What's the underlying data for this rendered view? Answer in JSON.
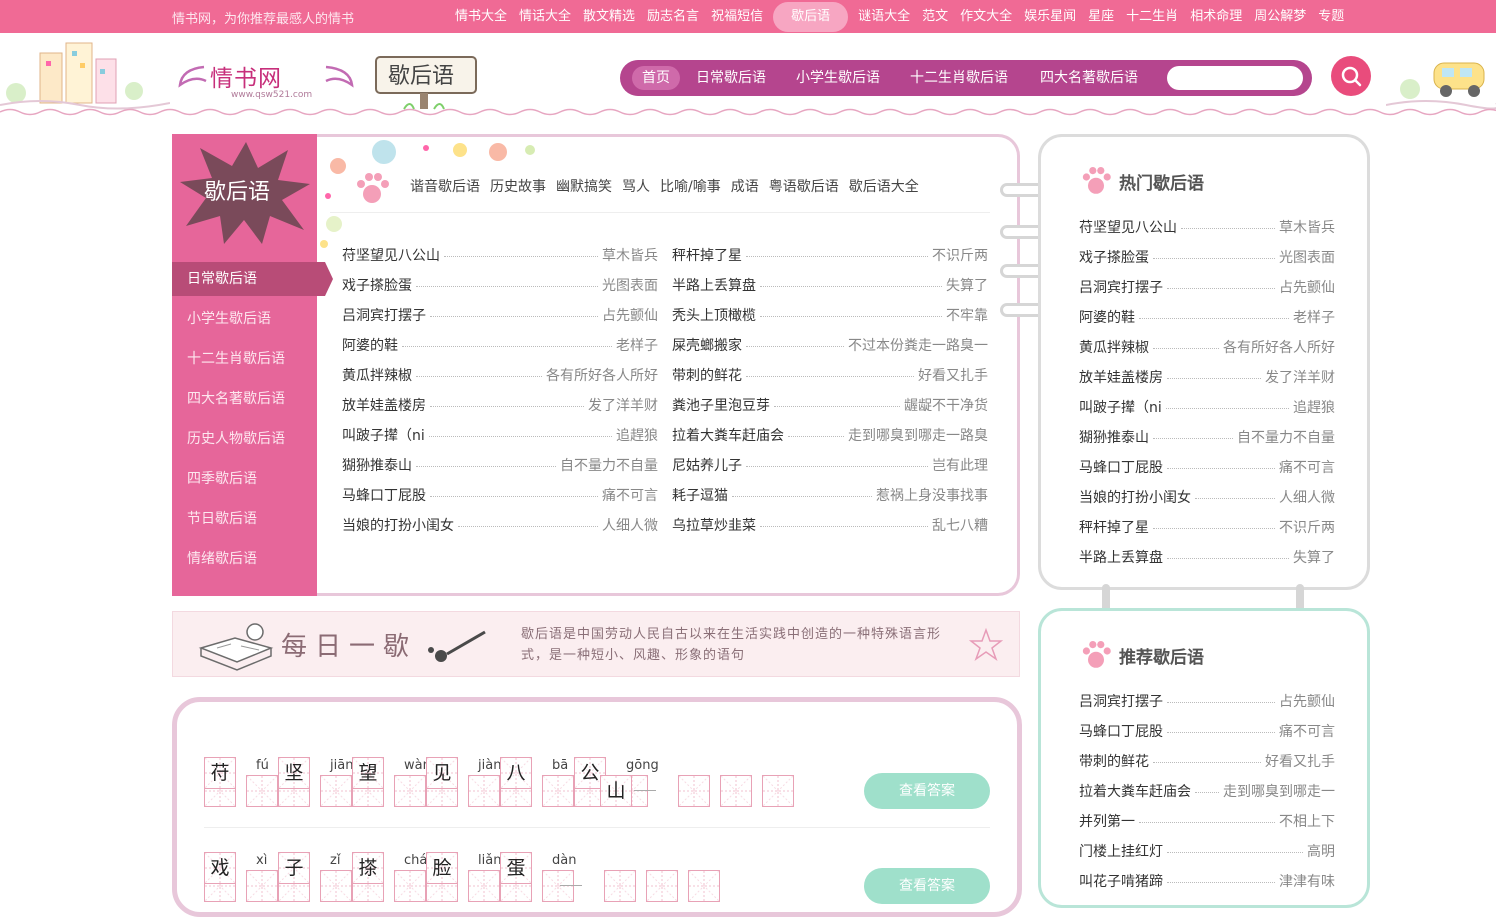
{
  "topbar": {
    "slogan": "情书网，为你推荐最感人的情书",
    "links": [
      "情书大全",
      "情话大全",
      "散文精选",
      "励志名言",
      "祝福短信",
      "歇后语",
      "谜语大全",
      "范文",
      "作文大全",
      "娱乐星闻",
      "星座",
      "十二生肖",
      "相术命理",
      "周公解梦",
      "专题"
    ],
    "active_index": 5
  },
  "header": {
    "logo_text": "情书网",
    "logo_url": "www.qsw521.com",
    "section_tag": "歇后语",
    "nav": [
      "首页",
      "日常歇后语",
      "小学生歇后语",
      "十二生肖歇后语",
      "四大名著歇后语"
    ],
    "search_placeholder": ""
  },
  "sidemenu": {
    "badge": "歇后语",
    "items": [
      "日常歇后语",
      "小学生歇后语",
      "十二生肖歇后语",
      "四大名著歇后语",
      "历史人物歇后语",
      "四季歇后语",
      "节日歇后语",
      "情绪歇后语"
    ],
    "active_index": 0
  },
  "subnav": [
    "谐音歇后语",
    "历史故事",
    "幽默搞笑",
    "骂人",
    "比喻/喻事",
    "成语",
    "粤语歇后语",
    "歇后语大全"
  ],
  "main_list_left": [
    {
      "q": "苻坚望见八公山",
      "a": "草木皆兵"
    },
    {
      "q": "戏子搽脸蛋",
      "a": "光图表面"
    },
    {
      "q": "吕洞宾打摆子",
      "a": "占先颤仙"
    },
    {
      "q": "阿婆的鞋",
      "a": "老样子"
    },
    {
      "q": "黄瓜拌辣椒",
      "a": "各有所好各人所好"
    },
    {
      "q": "放羊娃盖楼房",
      "a": "发了洋羊财"
    },
    {
      "q": "叫跛子撵（ni",
      "a": "追趕狼"
    },
    {
      "q": "猢狲推泰山",
      "a": "自不量力不自量"
    },
    {
      "q": "马蜂口丁屁股",
      "a": "痛不可言"
    },
    {
      "q": "当娘的打扮小闺女",
      "a": "人细人微"
    }
  ],
  "main_list_right": [
    {
      "q": "秤杆掉了星",
      "a": "不识斤两"
    },
    {
      "q": "半路上丢算盘",
      "a": "失算了"
    },
    {
      "q": "秃头上顶橄榄",
      "a": "不牢靠"
    },
    {
      "q": "屎壳螂搬家",
      "a": "不过本份粪走一路臭一"
    },
    {
      "q": "带刺的鲜花",
      "a": "好看又扎手"
    },
    {
      "q": "粪池子里泡豆芽",
      "a": "龌龊不干净货"
    },
    {
      "q": "拉着大粪车赶庙会",
      "a": "走到哪臭到哪走一路臭"
    },
    {
      "q": "尼姑养儿子",
      "a": "岂有此理"
    },
    {
      "q": "耗子逗猫",
      "a": "惹祸上身没事找事"
    },
    {
      "q": "乌拉草炒韭菜",
      "a": "乱七八糟"
    }
  ],
  "hot": {
    "title": "热门歇后语",
    "items": [
      {
        "q": "苻坚望见八公山",
        "a": "草木皆兵"
      },
      {
        "q": "戏子搽脸蛋",
        "a": "光图表面"
      },
      {
        "q": "吕洞宾打摆子",
        "a": "占先颤仙"
      },
      {
        "q": "阿婆的鞋",
        "a": "老样子"
      },
      {
        "q": "黄瓜拌辣椒",
        "a": "各有所好各人所好"
      },
      {
        "q": "放羊娃盖楼房",
        "a": "发了洋羊财"
      },
      {
        "q": "叫跛子撵（ni",
        "a": "追趕狼"
      },
      {
        "q": "猢狲推泰山",
        "a": "自不量力不自量"
      },
      {
        "q": "马蜂口丁屁股",
        "a": "痛不可言"
      },
      {
        "q": "当娘的打扮小闺女",
        "a": "人细人微"
      },
      {
        "q": "秤杆掉了星",
        "a": "不识斤两"
      },
      {
        "q": "半路上丢算盘",
        "a": "失算了"
      }
    ]
  },
  "recommend": {
    "title": "推荐歇后语",
    "items": [
      {
        "q": "吕洞宾打摆子",
        "a": "占先颤仙"
      },
      {
        "q": "马蜂口丁屁股",
        "a": "痛不可言"
      },
      {
        "q": "带刺的鲜花",
        "a": "好看又扎手"
      },
      {
        "q": "拉着大粪车赶庙会",
        "a": "走到哪臭到哪走一"
      },
      {
        "q": "并列第一",
        "a": "不相上下"
      },
      {
        "q": "门楼上挂红灯",
        "a": "高明"
      },
      {
        "q": "叫花子啃猪蹄",
        "a": "津津有味"
      }
    ]
  },
  "daily": {
    "title": "每日一歇",
    "desc": "歇后语是中国劳动人民自古以来在生活实践中创造的一种特殊语言形式，是一种短小、风趣、形象的语句"
  },
  "quiz": [
    {
      "chars": [
        "苻",
        "坚",
        "望",
        "见",
        "八",
        "公"
      ],
      "pinyin": [
        "fú",
        "jiān",
        "wàng",
        "jiàn",
        "bā",
        "gōng"
      ],
      "hint": "山",
      "button": "查看答案"
    },
    {
      "chars": [
        "戏",
        "子",
        "搽",
        "脸",
        "蛋"
      ],
      "pinyin": [
        "xì",
        "zǐ",
        "chá",
        "liǎn",
        "dàn"
      ],
      "button": "查看答案"
    }
  ]
}
